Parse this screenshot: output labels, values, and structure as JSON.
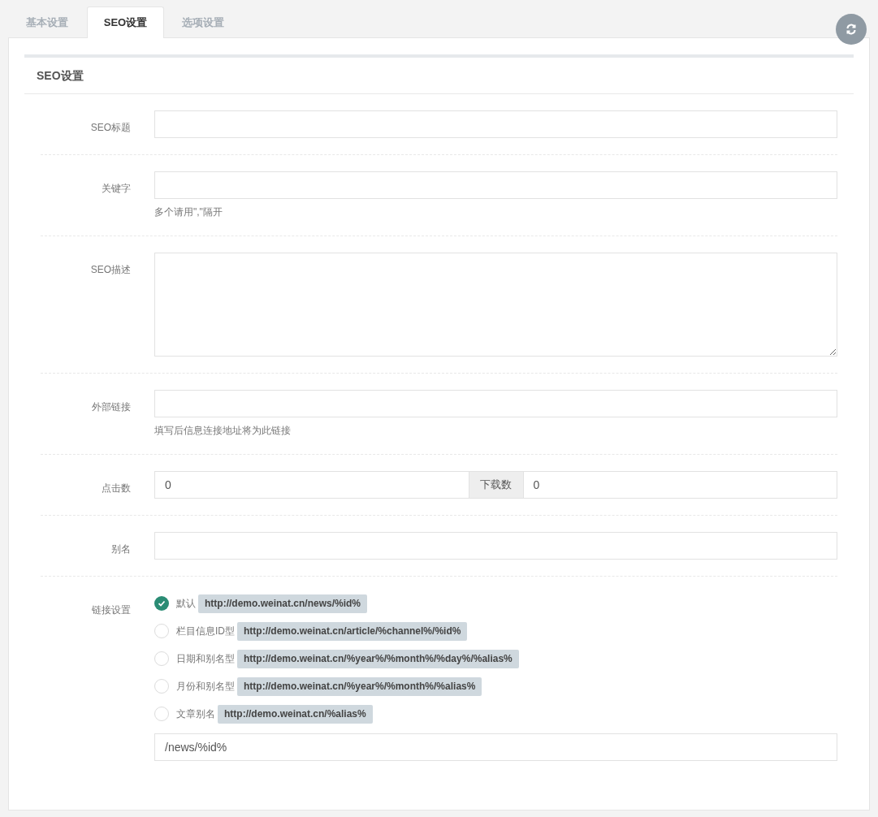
{
  "tabs": [
    {
      "label": "基本设置",
      "selected": false
    },
    {
      "label": "SEO设置",
      "selected": true
    },
    {
      "label": "选项设置",
      "selected": false
    }
  ],
  "section_title": "SEO设置",
  "fields": [
    {
      "kind": "text",
      "label": "SEO标题"
    },
    {
      "kind": "text",
      "label": "关键字",
      "help": "多个请用\",\"隔开"
    },
    {
      "kind": "textarea",
      "label": "SEO描述"
    },
    {
      "kind": "text",
      "label": "外部链接",
      "help": "填写后信息连接地址将为此链接"
    },
    {
      "kind": "pair",
      "label": "点击数",
      "value": "0",
      "addon_label": "下载数",
      "addon_value": "0"
    },
    {
      "kind": "text",
      "label": "别名"
    },
    {
      "kind": "radios",
      "label": "链接设置",
      "value": "/news/%id%",
      "options": [
        {
          "label": "默认",
          "url": "http://demo.weinat.cn/news/%id%",
          "selected": true
        },
        {
          "label": "栏目信息ID型",
          "url": "http://demo.weinat.cn/article/%channel%/%id%",
          "selected": false
        },
        {
          "label": "日期和别名型",
          "url": "http://demo.weinat.cn/%year%/%month%/%day%/%alias%",
          "selected": false
        },
        {
          "label": "月份和别名型",
          "url": "http://demo.weinat.cn/%year%/%month%/%alias%",
          "selected": false
        },
        {
          "label": "文章别名",
          "url": "http://demo.weinat.cn/%alias%",
          "selected": false
        }
      ]
    }
  ]
}
